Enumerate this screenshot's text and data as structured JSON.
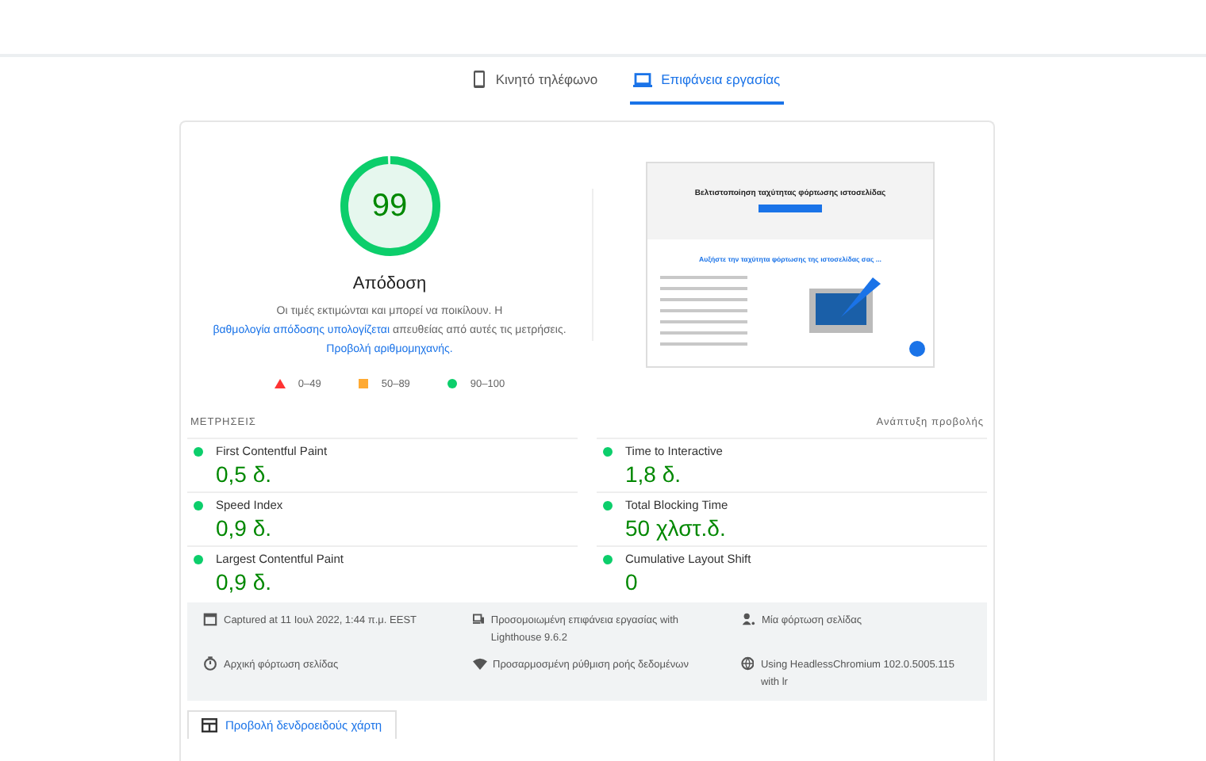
{
  "tabs": [
    {
      "label": "Κινητό τηλέφωνο",
      "kind": "phone",
      "selected": false
    },
    {
      "label": "Επιφάνεια εργασίας",
      "kind": "desktop",
      "selected": true
    }
  ],
  "score": {
    "value": "99",
    "level": 0.99,
    "title": "Απόδοση",
    "description": [
      {
        "kind": "text",
        "text": "Οι τιμές εκτιμώνται και μπορεί να ποικίλουν. Η "
      },
      {
        "kind": "link",
        "text": "βαθμολογία απόδοσης υπολογίζεται"
      },
      {
        "kind": "text",
        "text": " απευθείας από αυτές τις μετρήσεις. "
      },
      {
        "kind": "link",
        "text": "Προβολή αριθμομηχανής."
      }
    ],
    "legend": [
      {
        "kind": "triangle",
        "label": "0–49",
        "color": "#ff3333"
      },
      {
        "kind": "square",
        "label": "50–89",
        "color": "#ffaa33"
      },
      {
        "kind": "circle",
        "label": "90–100",
        "color": "#0cce6b"
      }
    ]
  },
  "preview": {
    "title": "Βελτιστοποίηση ταχύτητας φόρτωσης ιστοσελίδας",
    "subtitle": "Αυξήστε την ταχύτητα φόρτωσης της ιστοσελίδας σας ..."
  },
  "metrics_heading": "ΜΕΤΡΗΣΕΙΣ",
  "expand_link": "Ανάπτυξη προβολής",
  "metrics": [
    {
      "name": "First Contentful Paint",
      "value": "0,5 δ.",
      "color": "#0cce6b"
    },
    {
      "name": "Time to Interactive",
      "value": "1,8 δ.",
      "color": "#0cce6b"
    },
    {
      "name": "Speed Index",
      "value": "0,9 δ.",
      "color": "#0cce6b"
    },
    {
      "name": "Total Blocking Time",
      "value": "50 χλστ.δ.",
      "color": "#0cce6b"
    },
    {
      "name": "Largest Contentful Paint",
      "value": "0,9 δ.",
      "color": "#0cce6b"
    },
    {
      "name": "Cumulative Layout Shift",
      "value": "0",
      "color": "#0cce6b"
    }
  ],
  "runtime": [
    {
      "kind": "calendar",
      "text": "Captured at 11 Ιουλ 2022, 1:44 π.μ. EEST"
    },
    {
      "kind": "devices",
      "text": "Προσομοιωμένη επιφάνεια εργασίας with Lighthouse 9.6.2"
    },
    {
      "kind": "person",
      "text": "Μία φόρτωση σελίδας"
    },
    {
      "kind": "timer",
      "text": "Αρχική φόρτωση σελίδας"
    },
    {
      "kind": "wifi",
      "text": "Προσαρμοσμένη ρύθμιση ροής δεδομένων"
    },
    {
      "kind": "globe",
      "text": "Using HeadlessChromium 102.0.5005.115 with lr"
    }
  ],
  "treemap_button": "Προβολή δενδροειδούς χάρτη"
}
